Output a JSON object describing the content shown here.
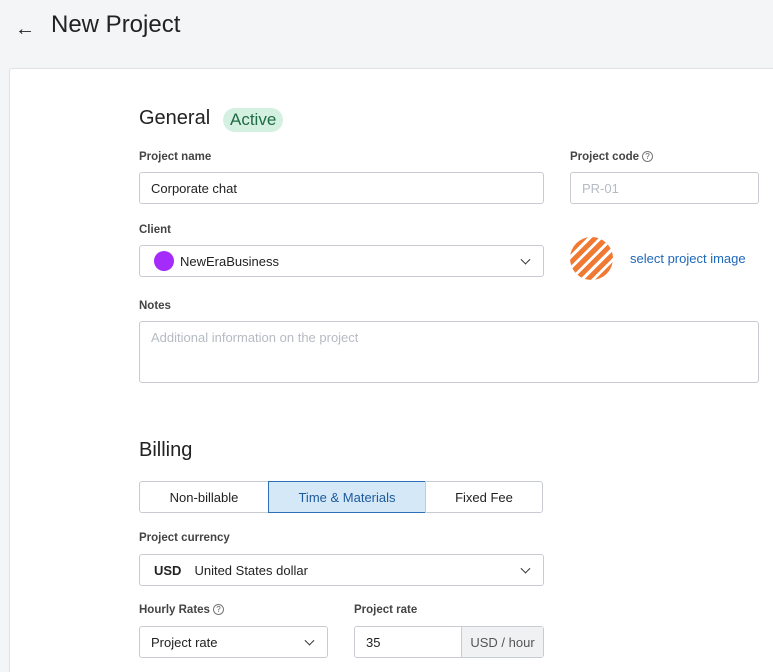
{
  "header": {
    "title": "New Project",
    "back_icon": "arrow-left-icon"
  },
  "general": {
    "title": "General",
    "status_badge": "Active",
    "project_name": {
      "label": "Project name",
      "value": "Corporate chat"
    },
    "project_code": {
      "label": "Project code",
      "placeholder": "PR-01",
      "help_icon": "question-circle-icon"
    },
    "client": {
      "label": "Client",
      "value": "NewEraBusiness",
      "avatar_color": "#a52bfa"
    },
    "project_image": {
      "link_text": "select project image"
    },
    "notes": {
      "label": "Notes",
      "placeholder": "Additional information on the project"
    }
  },
  "billing": {
    "title": "Billing",
    "options": [
      "Non-billable",
      "Time & Materials",
      "Fixed Fee"
    ],
    "selected_option": "Time & Materials",
    "currency": {
      "label": "Project currency",
      "code": "USD",
      "name": "United States dollar"
    },
    "hourly_rates": {
      "label": "Hourly Rates",
      "value": "Project rate",
      "help_icon": "question-circle-icon"
    },
    "project_rate": {
      "label": "Project rate",
      "value": "35",
      "unit": "USD / hour"
    }
  },
  "colors": {
    "accent": "#1d67b8",
    "badge_bg": "#d4f0e1",
    "badge_text": "#1e6b45",
    "selected_bg": "#d5e8f7"
  }
}
